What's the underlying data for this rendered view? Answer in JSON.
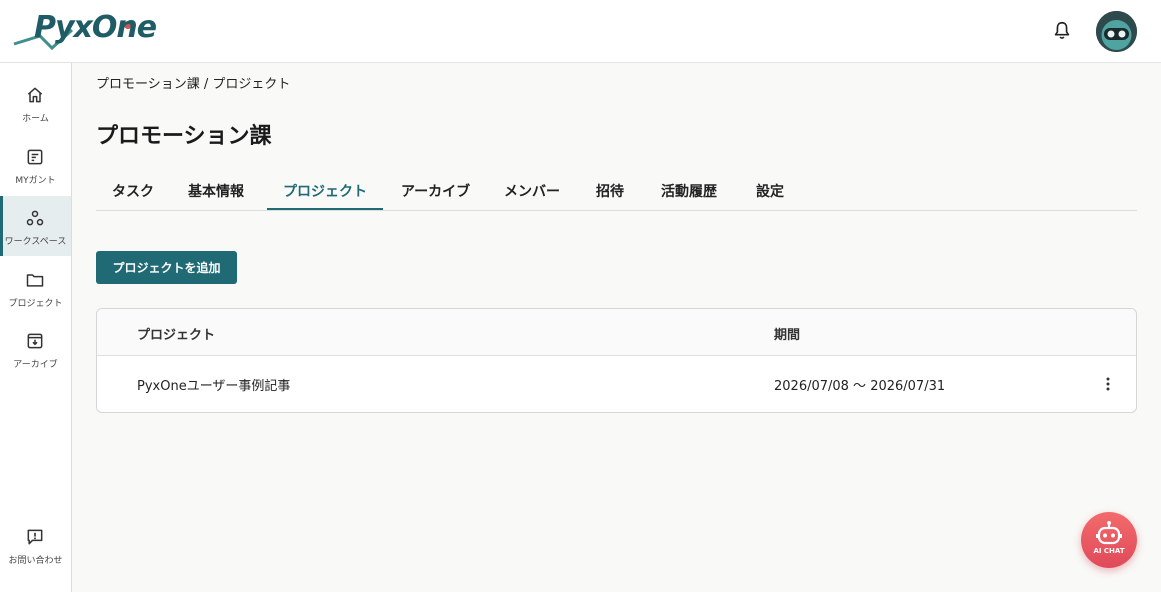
{
  "app": {
    "logo_text": "PyxOne"
  },
  "sidebar": {
    "items": [
      {
        "label": "ホーム",
        "icon": "home-icon"
      },
      {
        "label": "MYガント",
        "icon": "gantt-icon"
      },
      {
        "label": "ワークスペース",
        "icon": "workspace-icon",
        "active": true
      },
      {
        "label": "プロジェクト",
        "icon": "folder-icon"
      },
      {
        "label": "アーカイブ",
        "icon": "archive-icon"
      }
    ],
    "contact": {
      "label": "お問い合わせ",
      "icon": "feedback-icon"
    }
  },
  "breadcrumb": {
    "parent": "プロモーション課",
    "separator": " / ",
    "current": "プロジェクト"
  },
  "page": {
    "title": "プロモーション課"
  },
  "tabs": [
    {
      "label": "タスク"
    },
    {
      "label": "基本情報"
    },
    {
      "label": "プロジェクト",
      "active": true
    },
    {
      "label": "アーカイブ"
    },
    {
      "label": "メンバー"
    },
    {
      "label": "招待"
    },
    {
      "label": "活動履歴"
    },
    {
      "label": "設定"
    }
  ],
  "actions": {
    "add_project": "プロジェクトを追加"
  },
  "table": {
    "columns": [
      "プロジェクト",
      "期間"
    ],
    "rows": [
      {
        "name": "PyxOneユーザー事例記事",
        "period": "2026/07/08 〜 2026/07/31"
      }
    ]
  },
  "ai_chat": {
    "label": "AI CHAT"
  },
  "colors": {
    "accent": "#1f6a74",
    "ai_chat": "#e85a62"
  }
}
